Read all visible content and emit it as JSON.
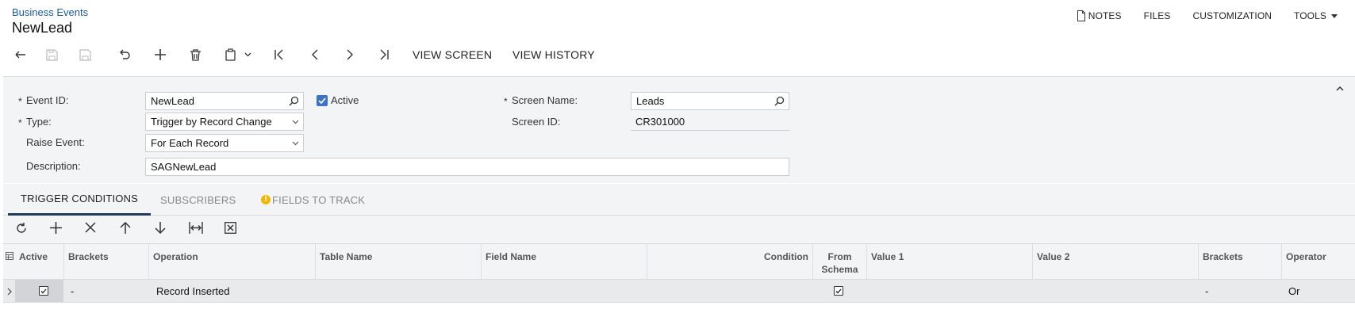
{
  "header": {
    "breadcrumb": "Business Events",
    "title": "NewLead"
  },
  "top_tools": {
    "notes": "NOTES",
    "files": "FILES",
    "customization": "CUSTOMIZATION",
    "tools": "TOOLS"
  },
  "toolbar": {
    "view_screen": "VIEW SCREEN",
    "view_history": "VIEW HISTORY"
  },
  "form": {
    "event_id_label": "Event ID:",
    "event_id_value": "NewLead",
    "active_label": "Active",
    "active_checked": true,
    "type_label": "Type:",
    "type_value": "Trigger by Record Change",
    "raise_event_label": "Raise Event:",
    "raise_event_value": "For Each Record",
    "description_label": "Description:",
    "description_value": "SAGNewLead",
    "screen_name_label": "Screen Name:",
    "screen_name_value": "Leads",
    "screen_id_label": "Screen ID:",
    "screen_id_value": "CR301000",
    "required_mark": "*"
  },
  "tabs": [
    {
      "label": "TRIGGER CONDITIONS",
      "active": true
    },
    {
      "label": "SUBSCRIBERS",
      "active": false
    },
    {
      "label": "FIELDS TO TRACK",
      "active": false,
      "warning": true
    }
  ],
  "grid": {
    "columns": [
      "Active",
      "Brackets",
      "Operation",
      "Table Name",
      "Field Name",
      "Condition",
      "From Schema",
      "Value 1",
      "Value 2",
      "Brackets",
      "Operator"
    ],
    "rows": [
      {
        "active": true,
        "brackets_open": "-",
        "operation": "Record Inserted",
        "table_name": "",
        "field_name": "",
        "condition": "",
        "from_schema": true,
        "value1": "",
        "value2": "",
        "brackets_close": "-",
        "operator": "Or"
      }
    ]
  },
  "colors": {
    "accent": "#3b73c4",
    "link": "#1a5ba5",
    "panel_bg": "#f3f4f6",
    "tab_active_underline": "#1f3a5a",
    "warning": "#f2b705"
  }
}
